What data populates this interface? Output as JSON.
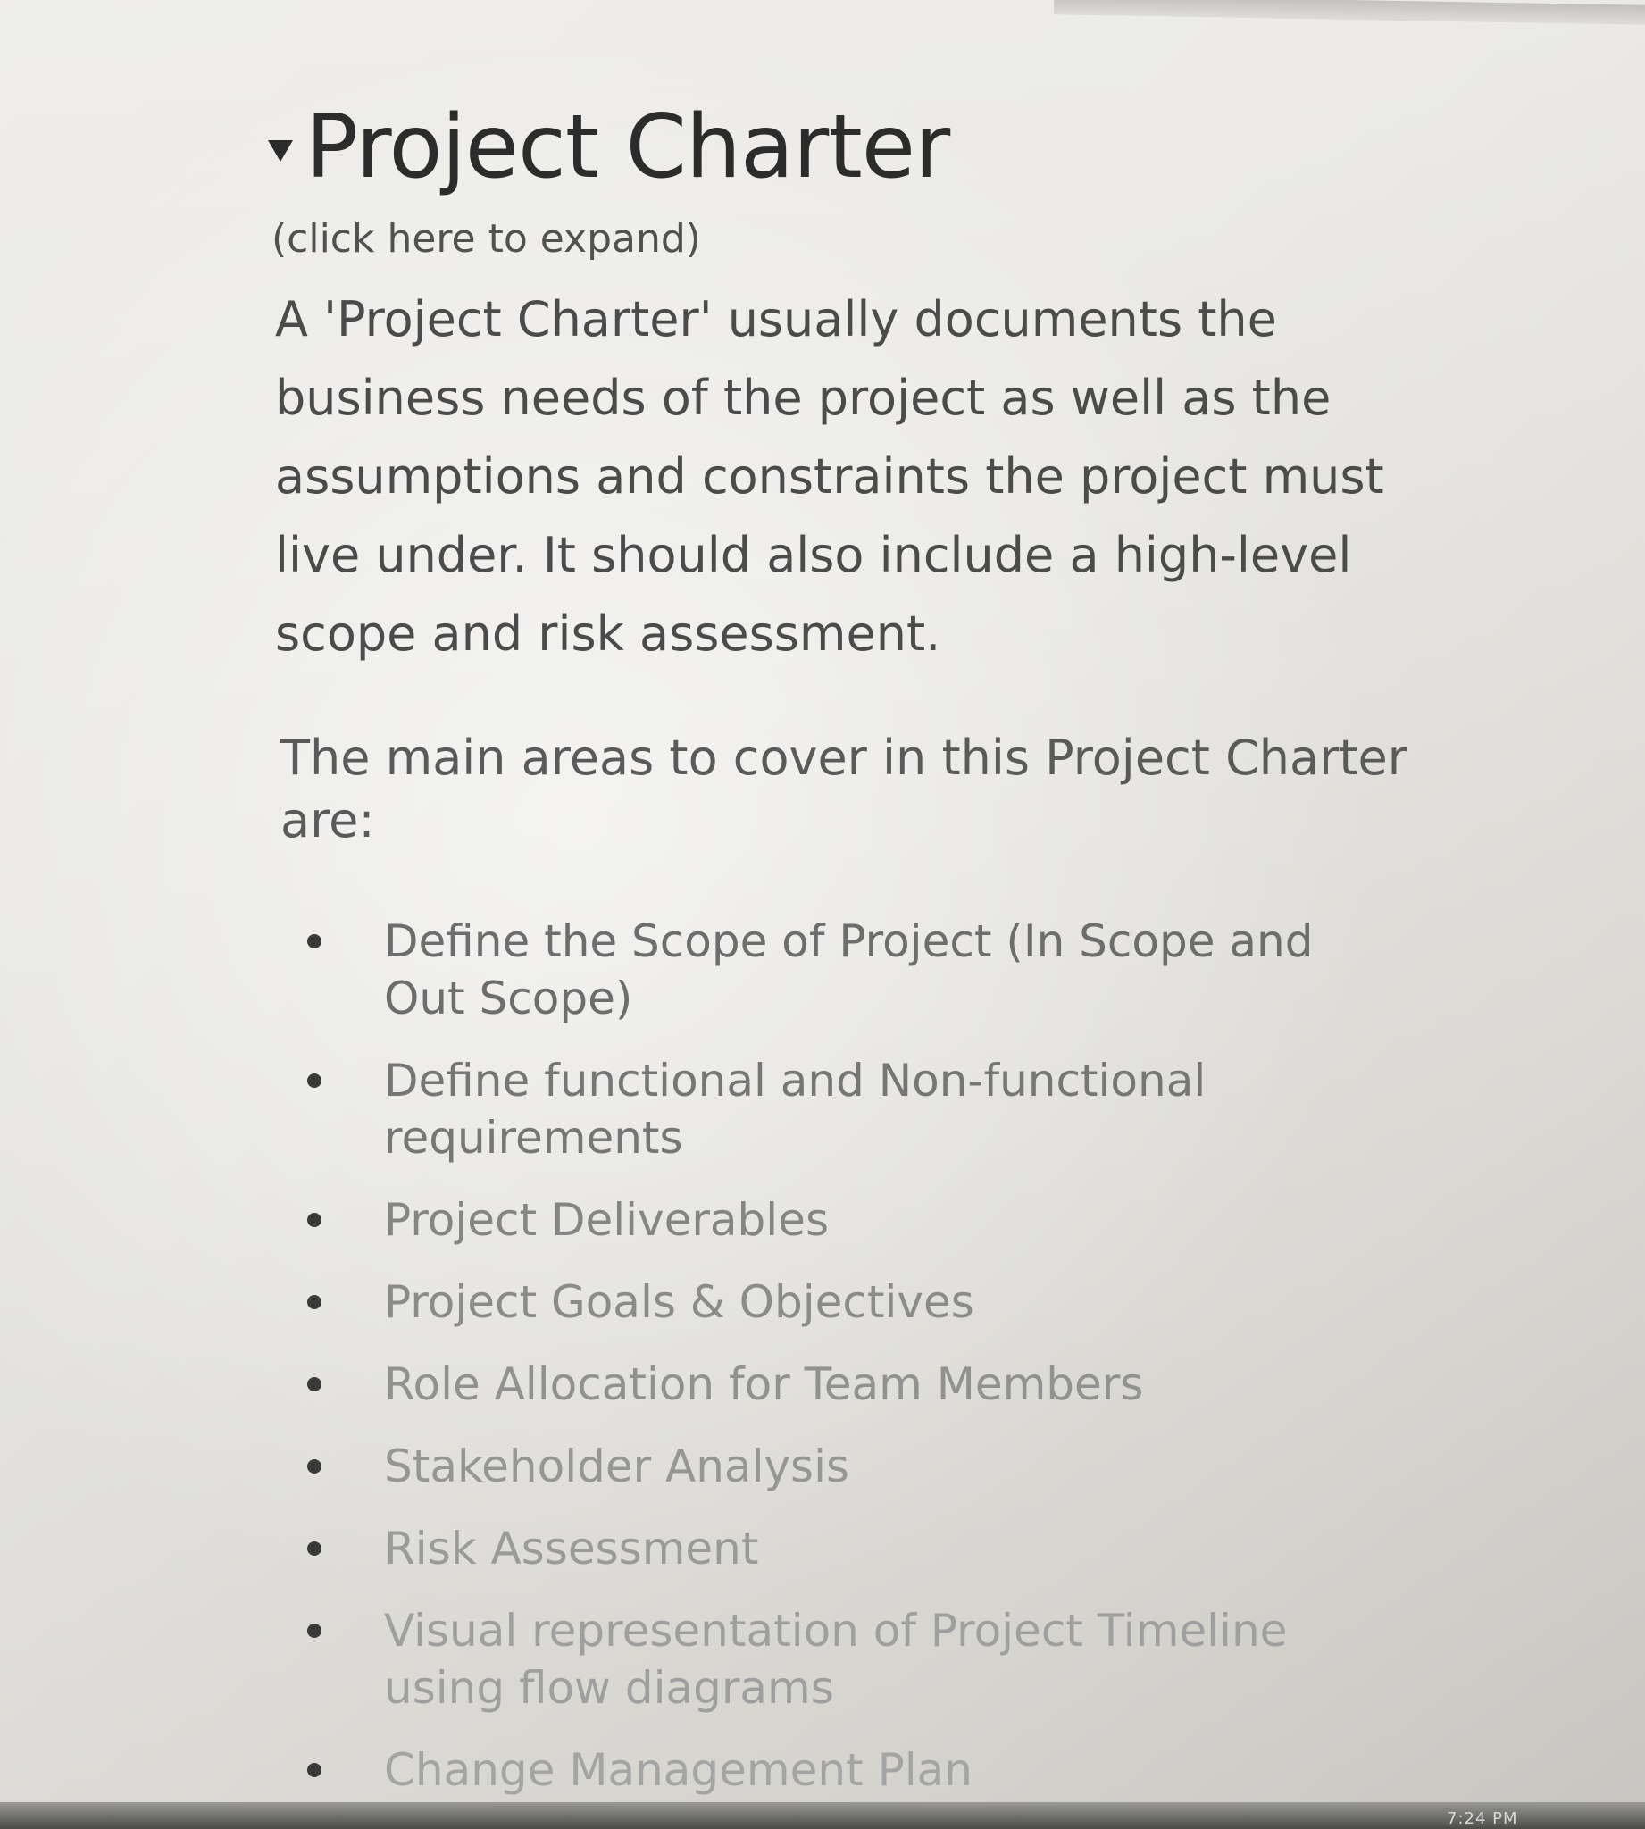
{
  "section": {
    "title": "Project Charter",
    "expand_hint": "(click here to expand)",
    "description": "A 'Project Charter' usually documents the business needs of the project as well as the assumptions and constraints the project must live under. It should also include a high-level scope and risk assessment.",
    "intro": "The main areas to cover in this Project Charter are:",
    "items": [
      {
        "label": "Define the Scope of Project (In Scope and Out Scope)"
      },
      {
        "label": "Define functional and Non-functional requirements"
      },
      {
        "label": "Project Deliverables"
      },
      {
        "label": "Project Goals & Objectives"
      },
      {
        "label": "Role Allocation for Team Members"
      },
      {
        "label": "Stakeholder Analysis"
      },
      {
        "label": "Risk Assessment"
      },
      {
        "label": "Visual representation of Project Timeline using flow diagrams"
      },
      {
        "label": "Change Management Plan"
      }
    ]
  },
  "taskbar": {
    "clock": "7:24 PM"
  }
}
